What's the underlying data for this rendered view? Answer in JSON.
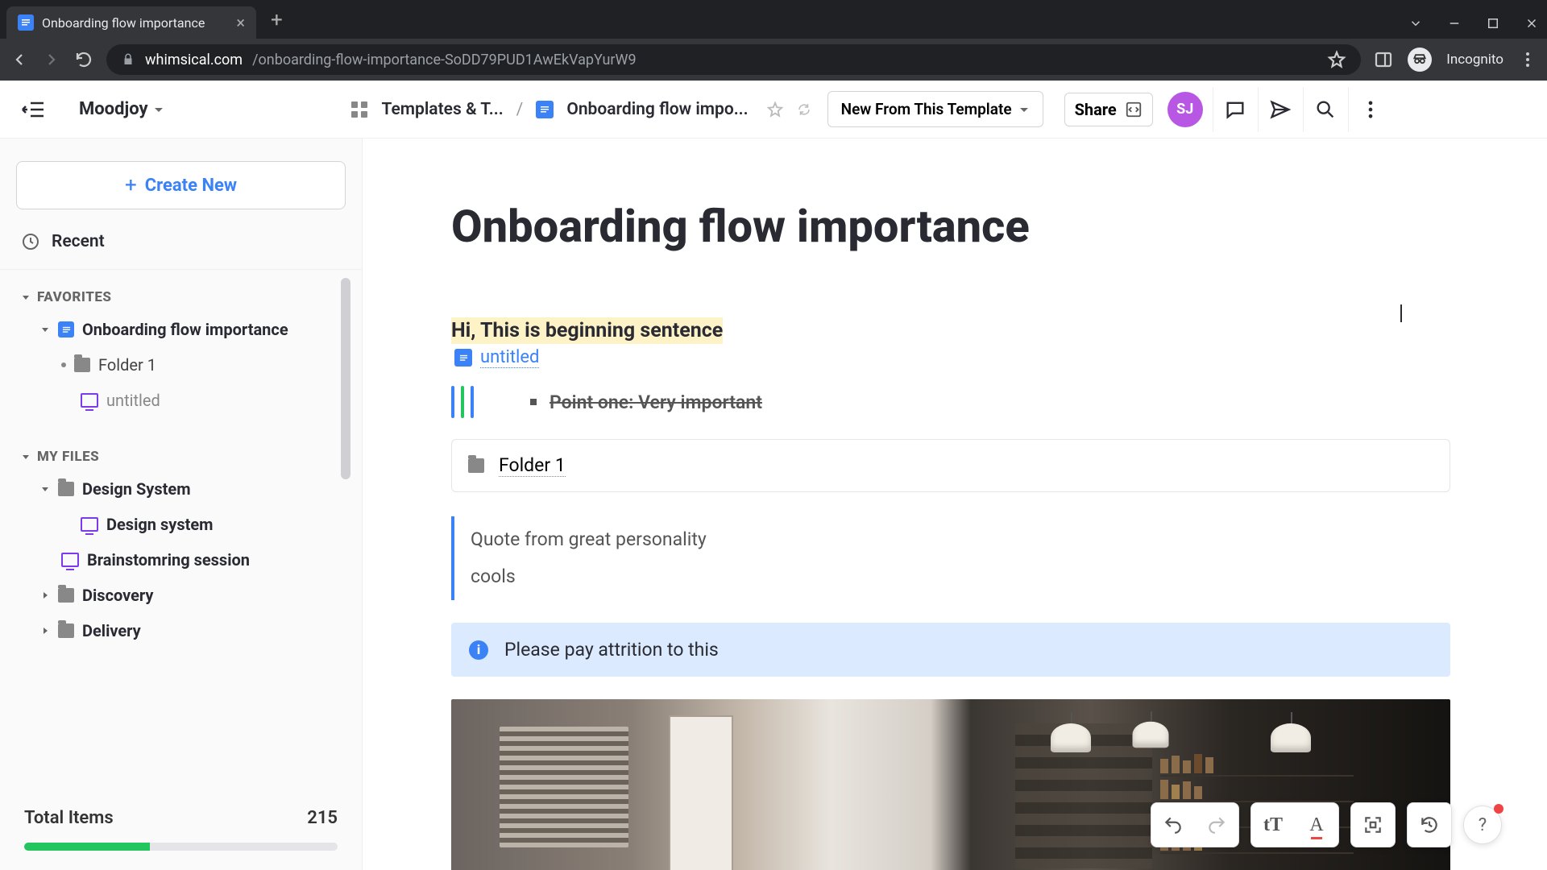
{
  "browser": {
    "tab_title": "Onboarding flow importance",
    "url_domain": "whimsical.com",
    "url_path": "/onboarding-flow-importance-SoDD79PUD1AwEkVapYurW9",
    "incognito_label": "Incognito"
  },
  "header": {
    "workspace": "Moodjoy",
    "breadcrumb_root": "Templates & T...",
    "breadcrumb_doc": "Onboarding flow impo...",
    "new_template": "New From This Template",
    "share": "Share",
    "user_initials": "SJ"
  },
  "sidebar": {
    "create": "Create New",
    "recent": "Recent",
    "favorites_label": "FAVORITES",
    "favorites": [
      {
        "label": "Onboarding flow importance",
        "type": "doc"
      },
      {
        "label": "Folder 1",
        "type": "folder"
      },
      {
        "label": "untitled",
        "type": "board"
      }
    ],
    "myfiles_label": "MY FILES",
    "myfiles": [
      {
        "label": "Design System",
        "type": "folder"
      },
      {
        "label": "Design system",
        "type": "board"
      },
      {
        "label": "Brainstomring session",
        "type": "board"
      },
      {
        "label": "Discovery",
        "type": "folder"
      },
      {
        "label": "Delivery",
        "type": "folder"
      }
    ],
    "total_label": "Total Items",
    "total_value": "215"
  },
  "doc": {
    "title": "Onboarding flow importance",
    "highlight": "Hi, This is beginning sentence",
    "linked_doc": "untitled",
    "bullet_struck": "Point one: Very important",
    "folder_ref": "Folder 1",
    "quote_line1": "Quote from great personality",
    "quote_line2": "cools",
    "callout": "Please pay attrition to this"
  }
}
